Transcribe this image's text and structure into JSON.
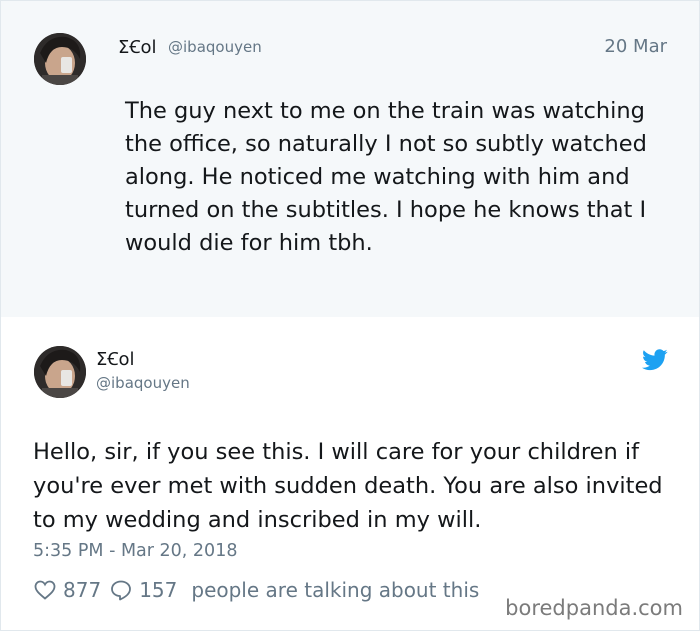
{
  "parent_tweet": {
    "display_name": "ΣꞒol",
    "handle": "@ibaqouyen",
    "date": "20 Mar",
    "text": "The guy next to me on the train was watching the office, so naturally I not so subtly watched along. He noticed me watching with him and turned on the subtitles. I hope he knows that I would die for him tbh."
  },
  "main_tweet": {
    "display_name": "ΣꞒol",
    "handle": "@ibaqouyen",
    "text": "Hello, sir, if you see this. I will care for your children if you're ever met with sudden death. You are also invited to my wedding and inscribed in my will.",
    "timestamp": "5:35 PM - Mar 20, 2018",
    "like_count": "877",
    "reply_count": "157",
    "talking_text": "people are talking about this"
  },
  "icons": {
    "bird": "twitter-bird-icon",
    "like": "heart-icon",
    "reply": "speech-bubble-icon"
  },
  "colors": {
    "parent_background": "#f5f8fa",
    "secondary_text": "#657786",
    "twitter_blue": "#1da1f2"
  },
  "watermark": "boredpanda.com"
}
